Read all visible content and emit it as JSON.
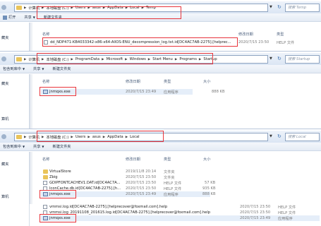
{
  "accent": "#e8343b",
  "window1": {
    "path": [
      "计算机",
      "本地磁盘 (C:)",
      "Users",
      "asus",
      "AppData",
      "Local",
      "Temp"
    ],
    "search_placeholder": "搜索 Temp",
    "toolbar": [
      "打开",
      "共享",
      "新建文件夹"
    ],
    "nav": [
      "藏夹"
    ],
    "columns": {
      "name": "名称",
      "date": "修改日期",
      "type": "类型"
    },
    "file": {
      "name": "dd_NDP471-KB4033342-x86-x64-AllOS-ENU_decompression_log.txt.id[DC4AC7AB-2275].[helprec...",
      "date": "2020/7/15 23:50",
      "type": "HELP 文件"
    }
  },
  "window2": {
    "path": [
      "计算机",
      "本地磁盘 (C:)",
      "ProgramData",
      "Microsoft",
      "Windows",
      "Start Menu",
      "Programs",
      "Startup"
    ],
    "search_placeholder": "搜索 Startup",
    "toolbar": [
      "包含到库中",
      "共享",
      "新建文件夹"
    ],
    "nav": [
      "藏夹",
      "算机"
    ],
    "columns": {
      "name": "名称",
      "date": "修改日期",
      "type": "类型",
      "size": "大小"
    },
    "file": {
      "name": "jnmqxs.exe",
      "date": "2020/7/15 23:49",
      "type": "应用程序",
      "size": "888 KB"
    }
  },
  "window3": {
    "path": [
      "计算机",
      "本地磁盘 (C:)",
      "Users",
      "asus",
      "AppData",
      "Local"
    ],
    "search_placeholder": "搜索 Local",
    "toolbar": [
      "包含到库中",
      "共享",
      "新建文件夹"
    ],
    "nav": [
      "藏夹",
      "算机"
    ],
    "columns": {
      "name": "名称",
      "date": "修改日期",
      "type": "类型",
      "size": "大小"
    },
    "rows": [
      {
        "name": "VirtualStore",
        "date": "2019/11/8 20:14",
        "type": "文件夹",
        "size": "",
        "icon": "folder"
      },
      {
        "name": "Zbig",
        "date": "2020/7/15 23:50",
        "type": "文件夹",
        "size": "",
        "icon": "folder"
      },
      {
        "name": "GDIPFONTCACHEV1.DAT.id[DC4AC7A...",
        "date": "2020/7/15 23:50",
        "type": "HELP 文件",
        "size": "57 KB",
        "icon": "file"
      },
      {
        "name": "IconCache.db.id[DC4AC7AB-2275].[h...",
        "date": "2020/7/15 23:50",
        "type": "HELP 文件",
        "size": "935 KB",
        "icon": "file"
      },
      {
        "name": "jnmqxs.exe",
        "date": "2020/7/15 23:49",
        "type": "应用程序",
        "size": "888 KB",
        "icon": "exe"
      }
    ],
    "overflow_rows": [
      {
        "name": "vmmsi.log.id[DC4AC7AB-2275].[helprecover@foxmail.com].help",
        "date": "2020/7/15 23:50",
        "type": "HELP 文件",
        "icon": "file"
      },
      {
        "name": "vmmsi.log_20191108_201615.log.id[DC4AC7AB-2275].[helprecover@foxmail.com].help",
        "date": "2020/7/15 23:50",
        "type": "HELP 文件",
        "icon": "file"
      },
      {
        "name": "jnmqxs.exe",
        "date": "2020/7/15 23:49",
        "type": "应用程序",
        "icon": "exe"
      }
    ]
  }
}
